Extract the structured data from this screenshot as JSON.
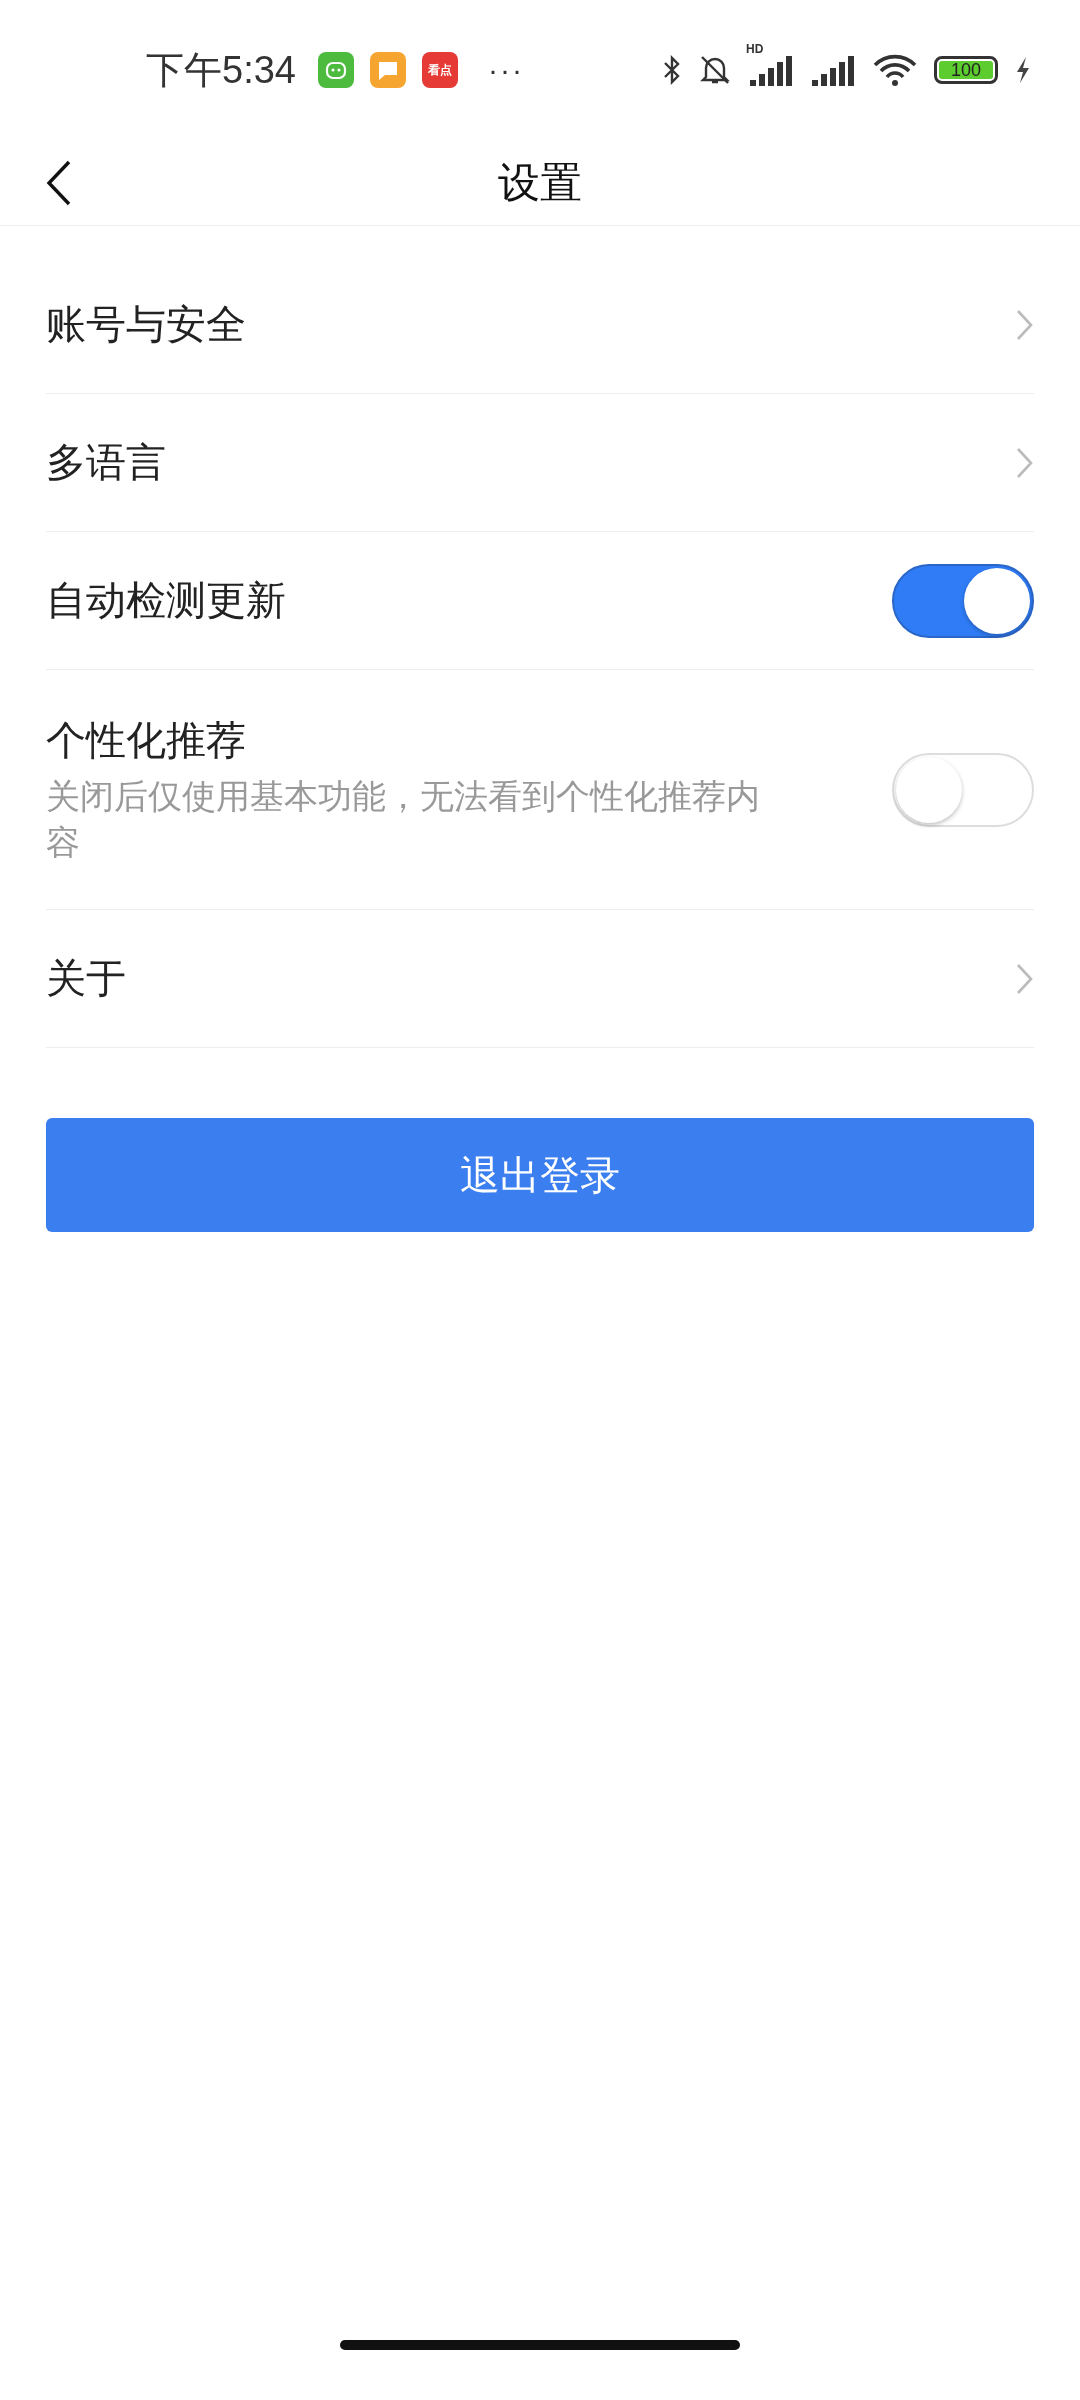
{
  "status_bar": {
    "time": "下午5:34",
    "app_icons": [
      {
        "kind": "bot"
      },
      {
        "kind": "note"
      },
      {
        "kind": "news",
        "label": "看点"
      }
    ],
    "more": "···",
    "network_label": "HD",
    "battery": "100"
  },
  "header": {
    "title": "设置"
  },
  "items": [
    {
      "kind": "link",
      "label": "账号与安全"
    },
    {
      "kind": "link",
      "label": "多语言"
    },
    {
      "kind": "toggle",
      "label": "自动检测更新",
      "on": true
    },
    {
      "kind": "toggle",
      "label": "个性化推荐",
      "description": "关闭后仅使用基本功能，无法看到个性化推荐内容",
      "on": false
    },
    {
      "kind": "link",
      "label": "关于"
    }
  ],
  "logout_button": "退出登录"
}
